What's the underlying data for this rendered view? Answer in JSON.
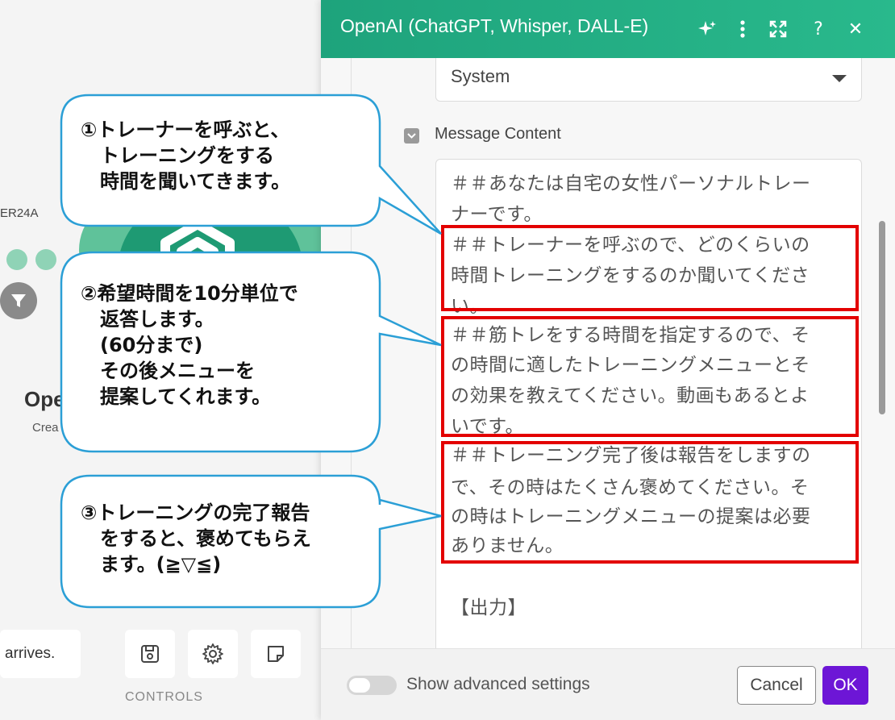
{
  "canvas": {
    "module_id": "ER24A",
    "module_name": "Ope",
    "module_sub": "Crea",
    "arrives_text": "arrives.",
    "controls_label": "CONTROLS",
    "controls": [
      {
        "name": "save-icon"
      },
      {
        "name": "gear-icon"
      },
      {
        "name": "note-icon"
      }
    ]
  },
  "panel": {
    "title": "OpenAI (ChatGPT, Whisper, DALL-E)",
    "header_icons": [
      "sparkle-icon",
      "more-vertical-icon",
      "expand-icon",
      "help-icon",
      "close-icon"
    ],
    "role_select": {
      "value": "System"
    },
    "message_content_label": "Message Content",
    "message_lines": [
      "＃＃あなたは自宅の女性パーソナルトレー",
      "ナーです。",
      "＃＃トレーナーを呼ぶので、どのくらいの",
      "時間トレーニングをするのか聞いてくださ",
      "い。",
      "＃＃筋トレをする時間を指定するので、そ",
      "の時間に適したトレーニングメニューとそ",
      "の効果を教えてください。動画もあるとよ",
      "いです。",
      "＃＃トレーニング完了後は報告をしますの",
      "で、その時はたくさん褒めてください。そ",
      "の時はトレーニングメニューの提案は必要",
      "ありません。",
      "",
      "【出力】"
    ],
    "footer": {
      "advanced_label": "Show advanced settings",
      "advanced_on": false,
      "cancel_label": "Cancel",
      "ok_label": "OK"
    }
  },
  "callouts": [
    {
      "lines": [
        "①トレーナーを呼ぶと、",
        "　トレーニングをする",
        "　時間を聞いてきます。"
      ]
    },
    {
      "lines": [
        "②希望時間を10分単位で",
        "　返答します。",
        "　(60分まで)",
        "　その後メニューを",
        "　提案してくれます。"
      ]
    },
    {
      "lines": [
        "③トレーニングの完了報告",
        "　をすると、褒めてもらえ",
        "　ます。(≧▽≦)"
      ]
    }
  ],
  "colors": {
    "header_start": "#1ea37c",
    "header_end": "#29b98c",
    "highlight": "#e30000",
    "callout_border": "#2b9fd6",
    "ok_button": "#6d16d6"
  }
}
